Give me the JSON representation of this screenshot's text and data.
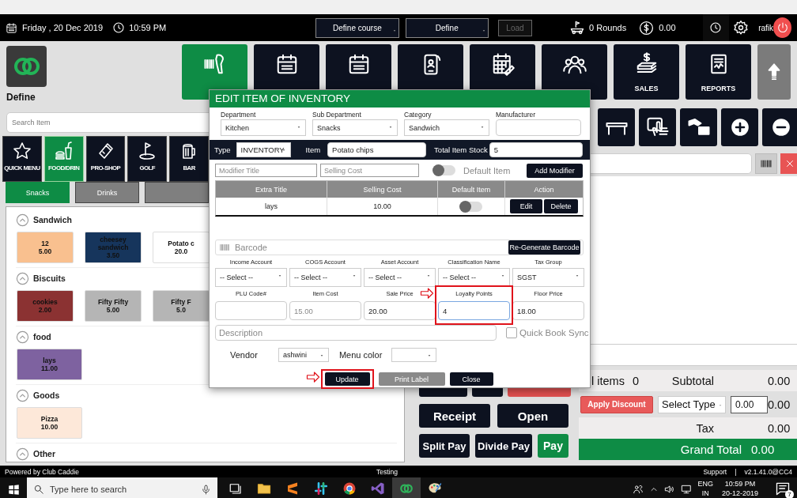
{
  "topbar": {
    "date": "Friday , 20 Dec 2019",
    "time": "10:59 PM",
    "course_select": "Define  course",
    "define_select": "Define",
    "load_button": {
      "label": "Load",
      "disabled": true
    },
    "rounds": "0 Rounds",
    "balance": "0.00",
    "user": "rafik"
  },
  "brand": {
    "name": "Define"
  },
  "nav_tiles": [
    {
      "kind": "scanner",
      "selected": true
    },
    {
      "kind": "calendar",
      "selected": false
    },
    {
      "kind": "calendar",
      "selected": false
    },
    {
      "kind": "phone",
      "selected": false
    },
    {
      "kind": "planner",
      "selected": false
    },
    {
      "kind": "people",
      "selected": false
    },
    {
      "kind": "money",
      "label": "SALES",
      "selected": false
    },
    {
      "kind": "report",
      "label": "REPORTS",
      "selected": false
    }
  ],
  "search": {
    "placeholder": "Search Item"
  },
  "categories": [
    {
      "kind": "star",
      "label": "QUICK MENU",
      "selected": false
    },
    {
      "kind": "food",
      "label": "FOOD/DRIN",
      "selected": true
    },
    {
      "kind": "bottle",
      "label": "PRO-SHOP",
      "selected": false
    },
    {
      "kind": "golf",
      "label": "GOLF",
      "selected": false
    },
    {
      "kind": "beer",
      "label": "BAR",
      "selected": false
    }
  ],
  "subcategories": [
    {
      "label": "Snacks",
      "selected": true
    },
    {
      "label": "Drinks",
      "selected": false
    },
    {
      "selected": false
    }
  ],
  "sections": [
    {
      "title": "Sandwich",
      "items": [
        {
          "name": "12",
          "price": "5.00",
          "color": "#f9c08f"
        },
        {
          "name": "cheesey sandwich",
          "price": "3.50",
          "color": "#16355c"
        },
        {
          "name": "Potato c",
          "price": "20.0",
          "color": "#ffffff"
        }
      ]
    },
    {
      "title": "Biscuits",
      "items": [
        {
          "name": "cookies",
          "price": "2.00",
          "color": "#8b3232"
        },
        {
          "name": "Fifty Fifty",
          "price": "5.00",
          "color": "#b5b5b5"
        },
        {
          "name": "Fifty F",
          "price": "5.0",
          "color": "#b5b5b5"
        }
      ]
    },
    {
      "title": "food",
      "items": [
        {
          "name": "lays",
          "price": "11.00",
          "color": "#7e62a0"
        }
      ]
    },
    {
      "title": "Goods",
      "items": [
        {
          "name": "Pizza",
          "price": "10.00",
          "color": "#fde8d9"
        }
      ]
    },
    {
      "title": "Other"
    }
  ],
  "tool_buttons": [
    {
      "kind": "table"
    },
    {
      "kind": "touch"
    },
    {
      "kind": "cardhand"
    },
    {
      "kind": "plus"
    },
    {
      "kind": "minus"
    }
  ],
  "actions": [
    {
      "label": "Receipt",
      "kind": "dark"
    },
    {
      "label": "Open",
      "kind": "dark"
    },
    {
      "label": "Split Pay",
      "kind": "dark"
    },
    {
      "label": "Divide Pay",
      "kind": "dark"
    },
    {
      "label": "Pay",
      "kind": "green"
    }
  ],
  "totals": {
    "items_label": "l items",
    "items_count": "0",
    "subtotal_label": "Subtotal",
    "subtotal": "0.00",
    "discount_button": "Apply Discount",
    "discount_type": "Select Type",
    "discount_value": "0.00",
    "discount_amount": "0.00",
    "tax_label": "Tax",
    "tax": "0.00",
    "grand_total_label": "Grand Total",
    "grand_total": "0.00"
  },
  "modal": {
    "title": "EDIT ITEM OF INVENTORY",
    "selects": [
      {
        "label": "Department",
        "value": "Kitchen"
      },
      {
        "label": "Sub Department",
        "value": "Snacks"
      },
      {
        "label": "Category",
        "value": "Sandwich"
      },
      {
        "label": "Manufacturer"
      }
    ],
    "type": {
      "label": "Type",
      "value": "INVENTORY"
    },
    "item": {
      "label": "Item",
      "value": "Potato chips"
    },
    "stock": {
      "label": "Total Item Stock",
      "value": "5"
    },
    "modifier_title": {
      "placeholder": "Modifier Title"
    },
    "selling_cost": {
      "placeholder": "Selling Cost"
    },
    "default_item": {
      "label": "Default Item",
      "on": false
    },
    "add_modifier": "Add Modifier",
    "modifier_table": {
      "columns": [
        "Extra Title",
        "Selling Cost",
        "Default Item",
        "Action"
      ],
      "rows": [
        {
          "title": "lays",
          "cost": "10.00",
          "default": false,
          "edit": "Edit",
          "delete": "Delete"
        }
      ]
    },
    "barcode": {
      "placeholder": "Barcode",
      "button": "Re-Generate Barcode"
    },
    "accounts": [
      {
        "label": "Income Account",
        "value": "-- Select --"
      },
      {
        "label": "COGS Account",
        "value": "-- Select --"
      },
      {
        "label": "Asset Account",
        "value": "-- Select --"
      },
      {
        "label": "Classification Name",
        "value": "-- Select --"
      },
      {
        "label": "Tax Group",
        "value": "SGST"
      }
    ],
    "prices": [
      {
        "label": "PLU Code#",
        "highlighted": false
      },
      {
        "label": "Item Cost",
        "value": "15.00",
        "disabled": true,
        "highlighted": false
      },
      {
        "label": "Sale Price",
        "value": "20.00",
        "disabled": false,
        "highlighted": false
      },
      {
        "label": "Loyalty Points",
        "value": "4",
        "disabled": false,
        "highlighted": true
      },
      {
        "label": "Floor Price",
        "value": "18.00",
        "disabled": false,
        "highlighted": false
      }
    ],
    "description": {
      "placeholder": "Description"
    },
    "quickbook_sync": {
      "label": "Quick Book Sync",
      "checked": false
    },
    "vendor": {
      "label": "Vendor",
      "value": "ashwini"
    },
    "menu_color": {
      "label": "Menu color"
    },
    "buttons": [
      {
        "label": "Update",
        "kind": "dark",
        "highlighted": true
      },
      {
        "label": "Print Label",
        "kind": "grey",
        "highlighted": false
      },
      {
        "label": "Close",
        "kind": "dark",
        "highlighted": false
      }
    ]
  },
  "status_bar": {
    "left": "Powered by Club Caddie",
    "center": "Testing",
    "support_link": "Support",
    "separator": "|",
    "version": "v2.1.41.0@CC4"
  },
  "taskbar": {
    "search_placeholder": "Type here to search",
    "apps": [
      {
        "kind": "taskview",
        "selected": false
      },
      {
        "kind": "folder",
        "selected": false
      },
      {
        "kind": "sublime",
        "selected": false
      },
      {
        "kind": "slack",
        "selected": false
      },
      {
        "kind": "chrome",
        "selected": false
      },
      {
        "kind": "vs",
        "selected": false
      },
      {
        "kind": "club",
        "selected": true
      },
      {
        "kind": "paint",
        "selected": false
      }
    ],
    "language": "ENG",
    "region": "IN",
    "time": "10:59 PM",
    "date": "20-12-2019",
    "notifications": "7"
  }
}
